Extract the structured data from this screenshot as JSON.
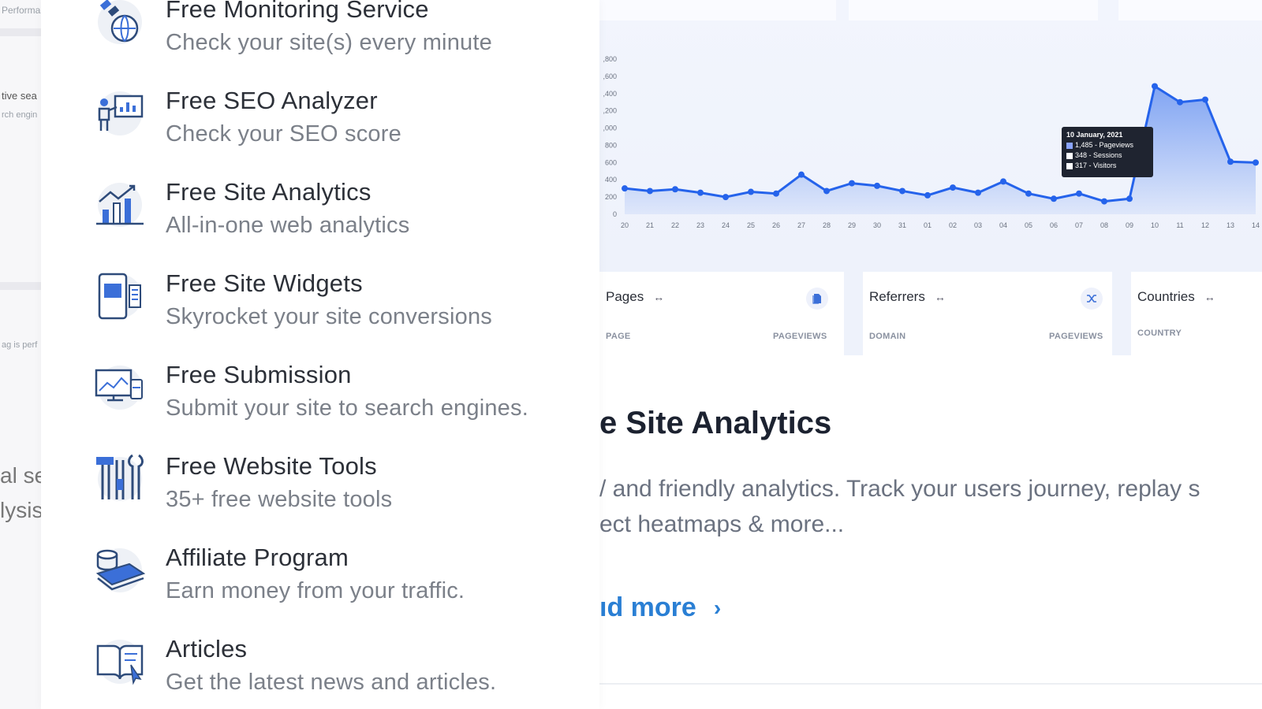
{
  "background_left": {
    "fragments": [
      "Performa",
      "tive sea",
      "rch engin",
      "ag is perf",
      "al se",
      "lysis"
    ]
  },
  "menu": {
    "items": [
      {
        "title": "Free Monitoring Service",
        "subtitle": "Check your site(s) every minute",
        "icon": "globe-satellite-icon"
      },
      {
        "title": "Free SEO Analyzer",
        "subtitle": "Check your SEO score",
        "icon": "presenter-chart-icon"
      },
      {
        "title": "Free Site Analytics",
        "subtitle": "All-in-one web analytics",
        "icon": "bar-chart-trend-icon"
      },
      {
        "title": "Free Site Widgets",
        "subtitle": "Skyrocket your site conversions",
        "icon": "mobile-widgets-icon"
      },
      {
        "title": "Free Submission",
        "subtitle": "Submit your site to search engines.",
        "icon": "monitor-submit-icon"
      },
      {
        "title": "Free Website Tools",
        "subtitle": "35+ free website tools",
        "icon": "tools-icon"
      },
      {
        "title": "Affiliate Program",
        "subtitle": "Earn money from your traffic.",
        "icon": "money-coins-icon"
      },
      {
        "title": "Articles",
        "subtitle": "Get the latest news and articles.",
        "icon": "open-book-cursor-icon"
      }
    ]
  },
  "chart_data": {
    "type": "area",
    "y_tick_labels": [
      ",800",
      ",600",
      ",400",
      ",200",
      ",000",
      "800",
      "600",
      "400",
      "200",
      "0"
    ],
    "categories": [
      "20",
      "21",
      "22",
      "23",
      "24",
      "25",
      "26",
      "27",
      "28",
      "29",
      "30",
      "31",
      "01",
      "02",
      "03",
      "04",
      "05",
      "06",
      "07",
      "08",
      "09",
      "10",
      "11",
      "12",
      "13",
      "14"
    ],
    "series": [
      {
        "name": "Pageviews",
        "values": [
          300,
          270,
          290,
          250,
          200,
          260,
          240,
          460,
          270,
          360,
          330,
          270,
          220,
          310,
          250,
          380,
          240,
          180,
          240,
          150,
          180,
          1485,
          1300,
          1330,
          610,
          600
        ]
      }
    ],
    "ylim": [
      0,
      1800
    ],
    "grid": false,
    "tooltip": {
      "date": "10 January, 2021",
      "lines": [
        "1,485 - Pageviews",
        "348 - Sessions",
        "317 - Visitors"
      ]
    },
    "color": "#2563eb"
  },
  "cards": [
    {
      "title": "Pages",
      "col_left": "PAGE",
      "col_right": "PAGEVIEWS",
      "badge": "page-icon"
    },
    {
      "title": "Referrers",
      "col_left": "DOMAIN",
      "col_right": "PAGEVIEWS",
      "badge": "shuffle-icon"
    },
    {
      "title": "Countries",
      "col_left": "COUNTRY",
      "col_right": ""
    }
  ],
  "card_arrow": "↔",
  "content": {
    "headline": "e Site Analytics",
    "desc_line1": "/ and friendly analytics. Track your users journey, replay s",
    "desc_line2": "ect heatmaps & more...",
    "read_more": "ıd more",
    "chevron": "›"
  },
  "colors": {
    "accent": "#2a7fd4",
    "chart_line": "#2563eb",
    "icon_blue": "#3b6fd8"
  }
}
